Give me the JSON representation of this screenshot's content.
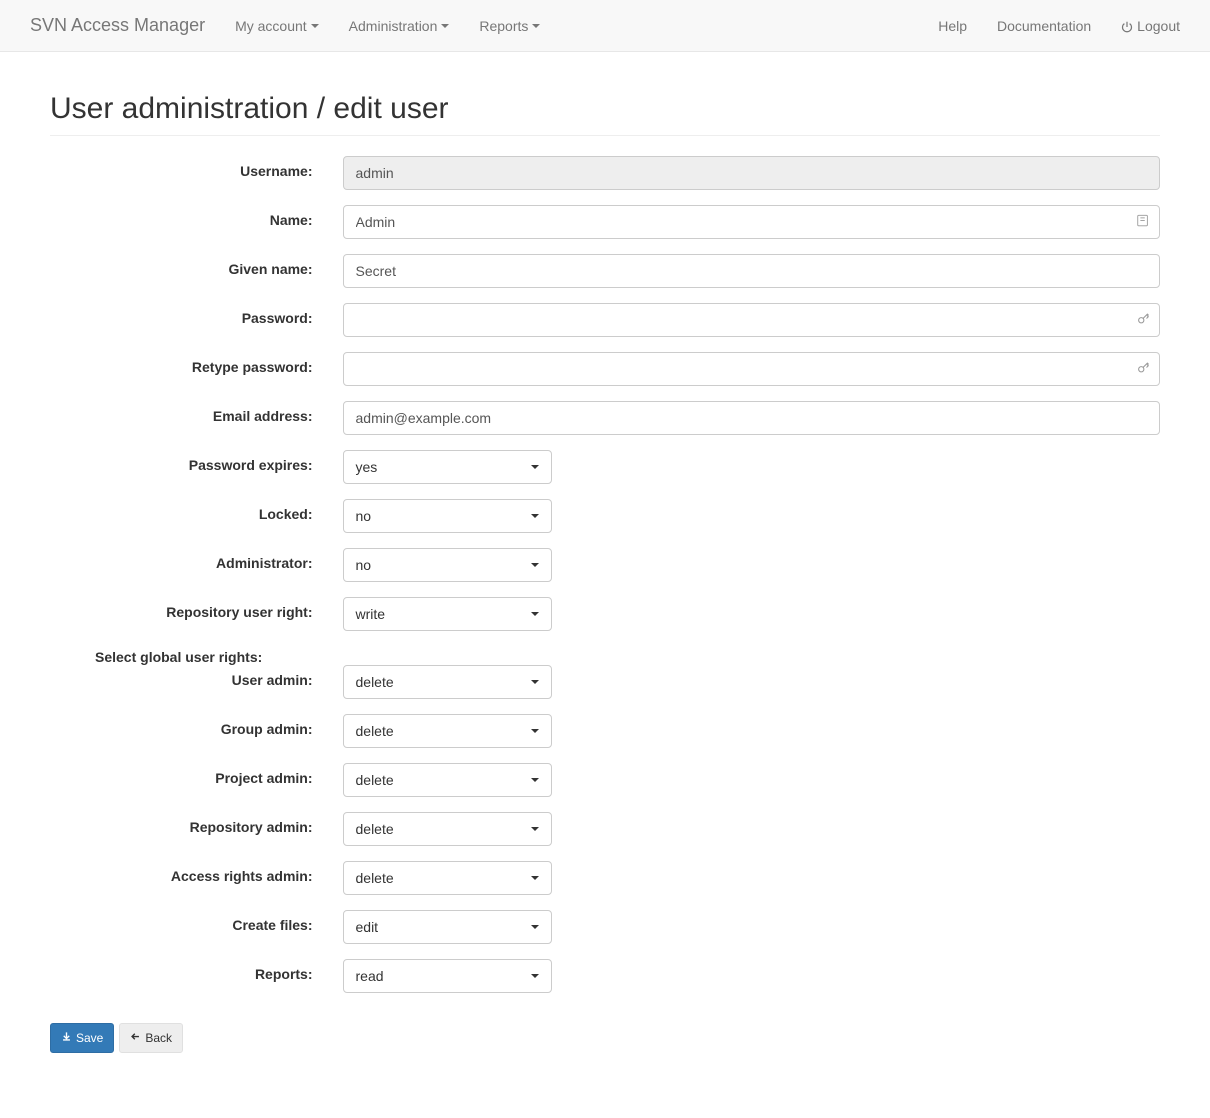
{
  "navbar": {
    "brand": "SVN Access Manager",
    "left": [
      {
        "label": "My account"
      },
      {
        "label": "Administration"
      },
      {
        "label": "Reports"
      }
    ],
    "right": [
      {
        "label": "Help"
      },
      {
        "label": "Documentation"
      },
      {
        "label": "Logout"
      }
    ]
  },
  "page_title": "User administration / edit user",
  "form": {
    "username": {
      "label": "Username:",
      "value": "admin"
    },
    "name": {
      "label": "Name:",
      "value": "Admin"
    },
    "given_name": {
      "label": "Given name:",
      "value": "Secret"
    },
    "password": {
      "label": "Password:",
      "value": ""
    },
    "retype_password": {
      "label": "Retype password:",
      "value": ""
    },
    "email": {
      "label": "Email address:",
      "value": "admin@example.com"
    },
    "password_expires": {
      "label": "Password expires:",
      "value": "yes"
    },
    "locked": {
      "label": "Locked:",
      "value": "no"
    },
    "administrator": {
      "label": "Administrator:",
      "value": "no"
    },
    "repo_user_right": {
      "label": "Repository user right:",
      "value": "write"
    }
  },
  "rights_header": "Select global user rights:",
  "rights": {
    "user_admin": {
      "label": "User admin:",
      "value": "delete"
    },
    "group_admin": {
      "label": "Group admin:",
      "value": "delete"
    },
    "project_admin": {
      "label": "Project admin:",
      "value": "delete"
    },
    "repository_admin": {
      "label": "Repository admin:",
      "value": "delete"
    },
    "access_rights_admin": {
      "label": "Access rights admin:",
      "value": "delete"
    },
    "create_files": {
      "label": "Create files:",
      "value": "edit"
    },
    "reports": {
      "label": "Reports:",
      "value": "read"
    }
  },
  "buttons": {
    "save": "Save",
    "back": "Back"
  }
}
